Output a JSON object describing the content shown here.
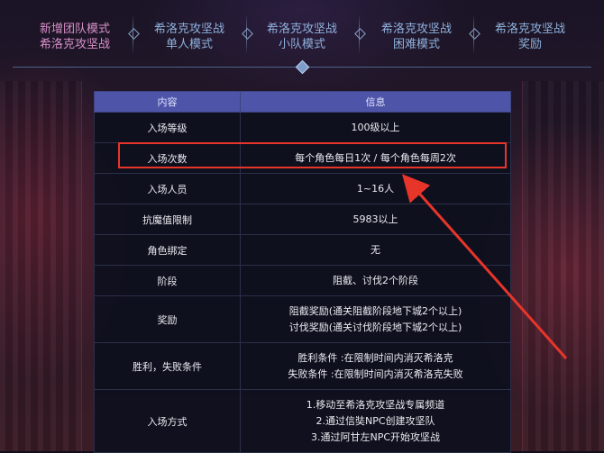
{
  "tabs": [
    {
      "line1": "新增团队模式",
      "line2": "希洛克攻坚战"
    },
    {
      "line1": "希洛克攻坚战",
      "line2": "单人模式"
    },
    {
      "line1": "希洛克攻坚战",
      "line2": "小队模式"
    },
    {
      "line1": "希洛克攻坚战",
      "line2": "困难模式"
    },
    {
      "line1": "希洛克攻坚战",
      "line2": "奖励"
    }
  ],
  "table": {
    "headers": [
      "内容",
      "信息"
    ],
    "rows": [
      {
        "label": "入场等级",
        "lines": [
          "100级以上"
        ]
      },
      {
        "label": "入场次数",
        "lines": [
          "每个角色每日1次 / 每个角色每周2次"
        ]
      },
      {
        "label": "入场人员",
        "lines": [
          "1~16人"
        ]
      },
      {
        "label": "抗魔值限制",
        "lines": [
          "5983以上"
        ]
      },
      {
        "label": "角色绑定",
        "lines": [
          "无"
        ]
      },
      {
        "label": "阶段",
        "lines": [
          "阻截、讨伐2个阶段"
        ]
      },
      {
        "label": "奖励",
        "lines": [
          "阻截奖励(通关阻截阶段地下城2个以上)",
          "讨伐奖励(通关讨伐阶段地下城2个以上)"
        ]
      },
      {
        "label": "胜利，失败条件",
        "lines": [
          "胜利条件 :在限制时间内消灭希洛克",
          "失败条件 :在限制时间内消灭希洛克失败"
        ]
      },
      {
        "label": "入场方式",
        "lines": [
          "1.移动至希洛克攻坚战专属频道",
          "2.通过信奘NPC创建攻坚队",
          "3.通过阿甘左NPC开始攻坚战"
        ]
      }
    ]
  },
  "colors": {
    "active_tab": "#d88fc8",
    "tab": "#8fb1dc",
    "header": "#4e55a8",
    "highlight": "#e8352a"
  }
}
